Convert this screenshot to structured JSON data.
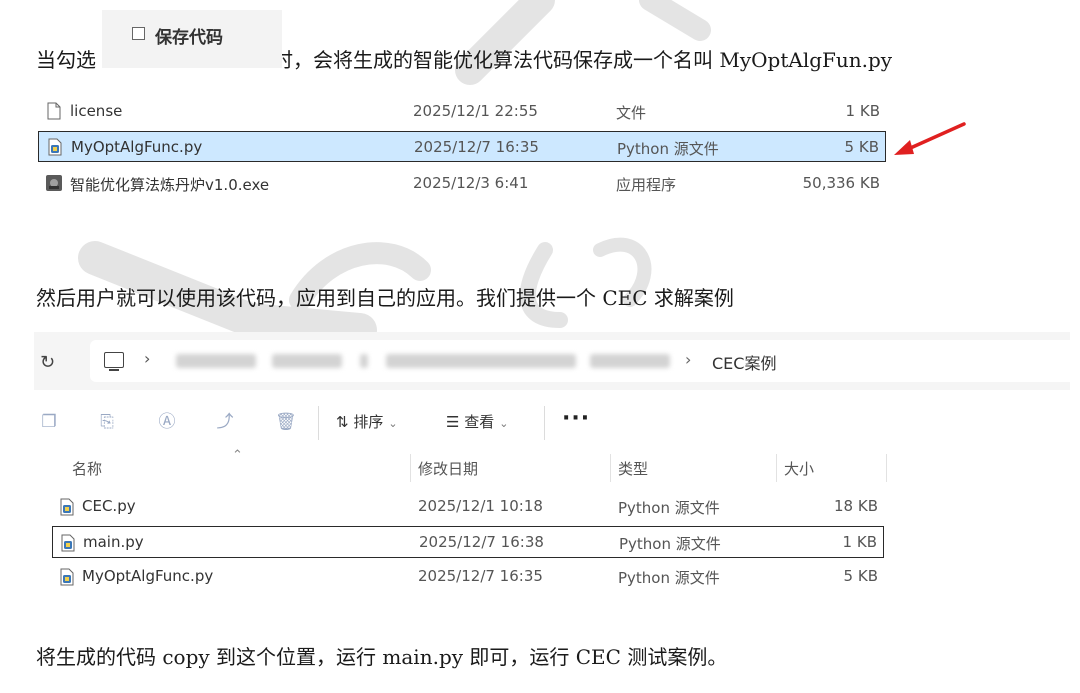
{
  "paragraphs": {
    "p1_before": "当勾选",
    "p1_after": "时，会将生成的智能优化算法代码保存成一个名叫 MyOptAlgFun.py",
    "p2": "然后用户就可以使用该代码，应用到自己的应用。我们提供一个 CEC 求解案例",
    "p3": "将生成的代码 copy 到这个位置，运行 main.py 即可，运行 CEC 测试案例。"
  },
  "save_snippet": {
    "label": "保存代码",
    "checked": false
  },
  "file_list_1": [
    {
      "icon": "document-icon",
      "name": "license",
      "date": "2025/12/1 22:55",
      "type": "文件",
      "size": "1 KB",
      "selected": false
    },
    {
      "icon": "python-file-icon",
      "name": "MyOptAlgFunc.py",
      "date": "2025/12/7 16:35",
      "type": "Python 源文件",
      "size": "5 KB",
      "selected": true
    },
    {
      "icon": "exe-app-icon",
      "name": "智能优化算法炼丹炉v1.0.exe",
      "date": "2025/12/3 6:41",
      "type": "应用程序",
      "size": "50,336 KB",
      "selected": false
    }
  ],
  "explorer": {
    "breadcrumb_last": "CEC案例",
    "toolbar": {
      "sort_label": "排序",
      "view_label": "查看",
      "more_label": "···"
    },
    "columns": {
      "name": "名称",
      "date": "修改日期",
      "type": "类型",
      "size": "大小"
    },
    "files": [
      {
        "name": "CEC.py",
        "date": "2025/12/1 10:18",
        "type": "Python 源文件",
        "size": "18 KB"
      },
      {
        "name": "main.py",
        "date": "2025/12/7 16:38",
        "type": "Python 源文件",
        "size": "1 KB"
      },
      {
        "name": "MyOptAlgFunc.py",
        "date": "2025/12/7 16:35",
        "type": "Python 源文件",
        "size": "5 KB"
      }
    ]
  },
  "colors": {
    "selection": "#cde8ff",
    "arrow": "#e02020",
    "watermark": "#d9d9d9"
  }
}
